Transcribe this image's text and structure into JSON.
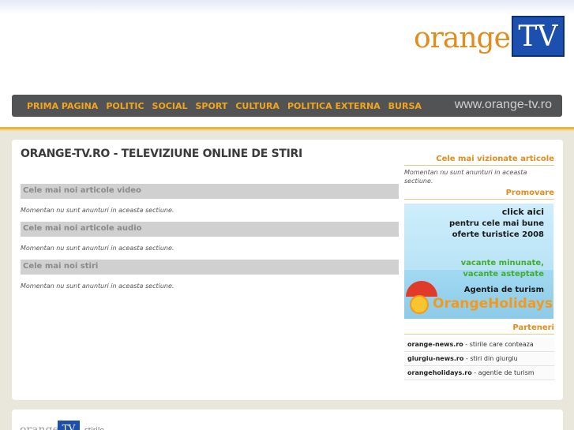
{
  "header": {
    "logo_word": "orange",
    "logo_tv": "TV"
  },
  "nav": {
    "items": [
      "PRIMA PAGINA",
      "POLITIC",
      "SOCIAL",
      "SPORT",
      "CULTURA",
      "POLITICA EXTERNA",
      "BURSA"
    ],
    "url": "www.orange-tv.ro"
  },
  "main": {
    "title": "ORANGE-TV.RO - TELEVIZIUNE ONLINE DE STIRI",
    "sections": [
      {
        "heading": "Cele mai noi articole video",
        "empty": "Momentan nu sunt anunturi in aceasta sectiune."
      },
      {
        "heading": "Cele mai noi articole audio",
        "empty": "Momentan nu sunt anunturi in aceasta sectiune."
      },
      {
        "heading": "Cele mai noi stiri",
        "empty": "Momentan nu sunt anunturi in aceasta sectiune."
      }
    ]
  },
  "sidebar": {
    "most_viewed_heading": "Cele mai vizionate articole",
    "most_viewed_empty": "Momentan nu sunt anunturi in aceasta sectiune.",
    "promo_heading": "Promovare",
    "promo": {
      "line1": "click aici",
      "line2": "pentru cele mai bune",
      "line3": "oferte turistice 2008",
      "green1": "vacante minunate,",
      "green2": "vacante asteptate",
      "line4": "Agentia de turism",
      "brand": "OrangeHolidays"
    },
    "partners_heading": "Parteneri",
    "partners": [
      {
        "name": "orange-news.ro",
        "desc": " - stirile care conteaza"
      },
      {
        "name": "giurgiu-news.ro",
        "desc": " - stiri din giurgiu"
      },
      {
        "name": "orangeholidays.ro",
        "desc": " - agentie de turism"
      }
    ]
  },
  "footer": {
    "logo_word": "orange",
    "logo_tv": "TV",
    "text": "stirile"
  },
  "colors": {
    "accent_orange": "#e38b1b",
    "nav_bg": "#515355",
    "logo_blue": "#1d4faf"
  }
}
